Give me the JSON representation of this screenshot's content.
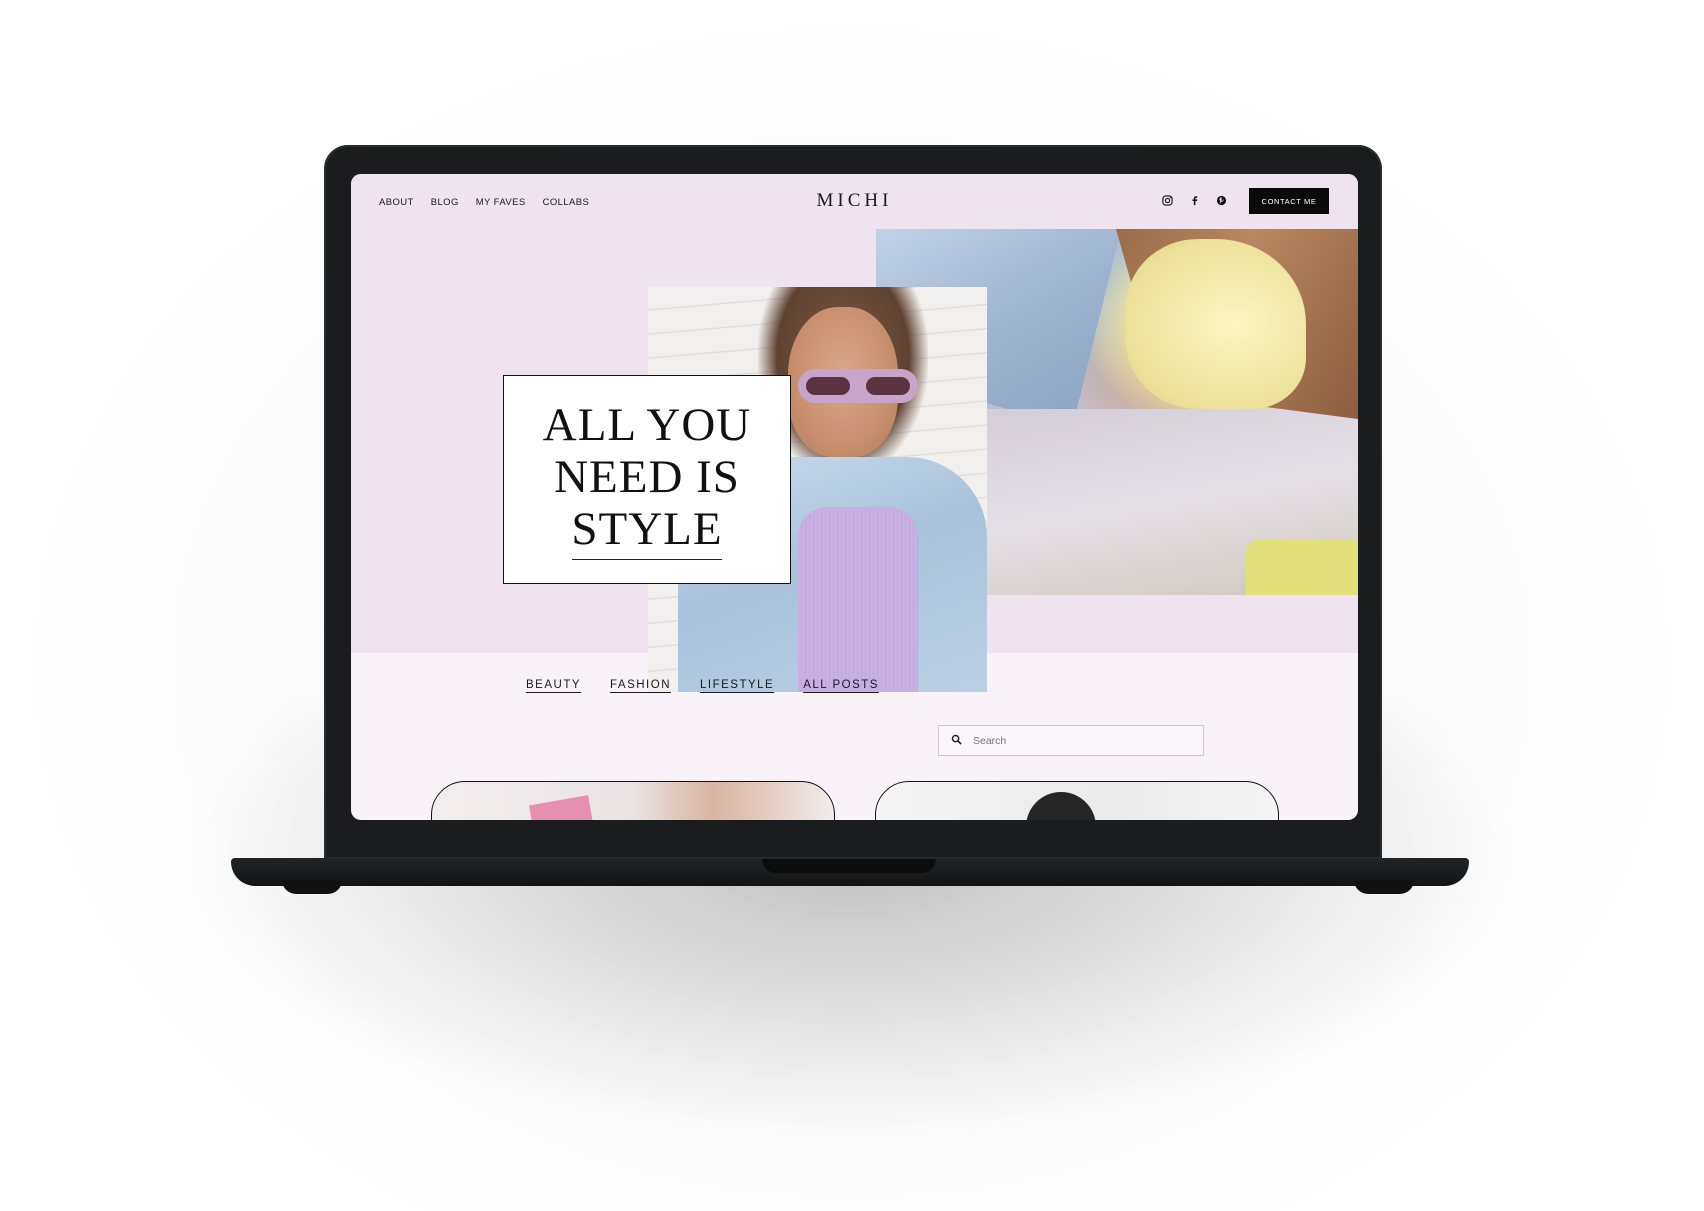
{
  "nav": {
    "links": [
      "ABOUT",
      "BLOG",
      "MY FAVES",
      "COLLABS"
    ],
    "logo": "MICHI",
    "social": [
      "instagram-icon",
      "facebook-icon",
      "pinterest-icon"
    ],
    "contact_label": "CONTACT ME"
  },
  "hero": {
    "line1": "ALL YOU",
    "line2": "NEED IS",
    "line3": "STYLE"
  },
  "categories": [
    "BEAUTY",
    "FASHION",
    "LIFESTYLE",
    "ALL POSTS"
  ],
  "search": {
    "placeholder": "Search"
  },
  "colors": {
    "hero_bg": "#efe3ef",
    "page_bg": "#f9f2f8",
    "button_bg": "#0a0a0a"
  }
}
